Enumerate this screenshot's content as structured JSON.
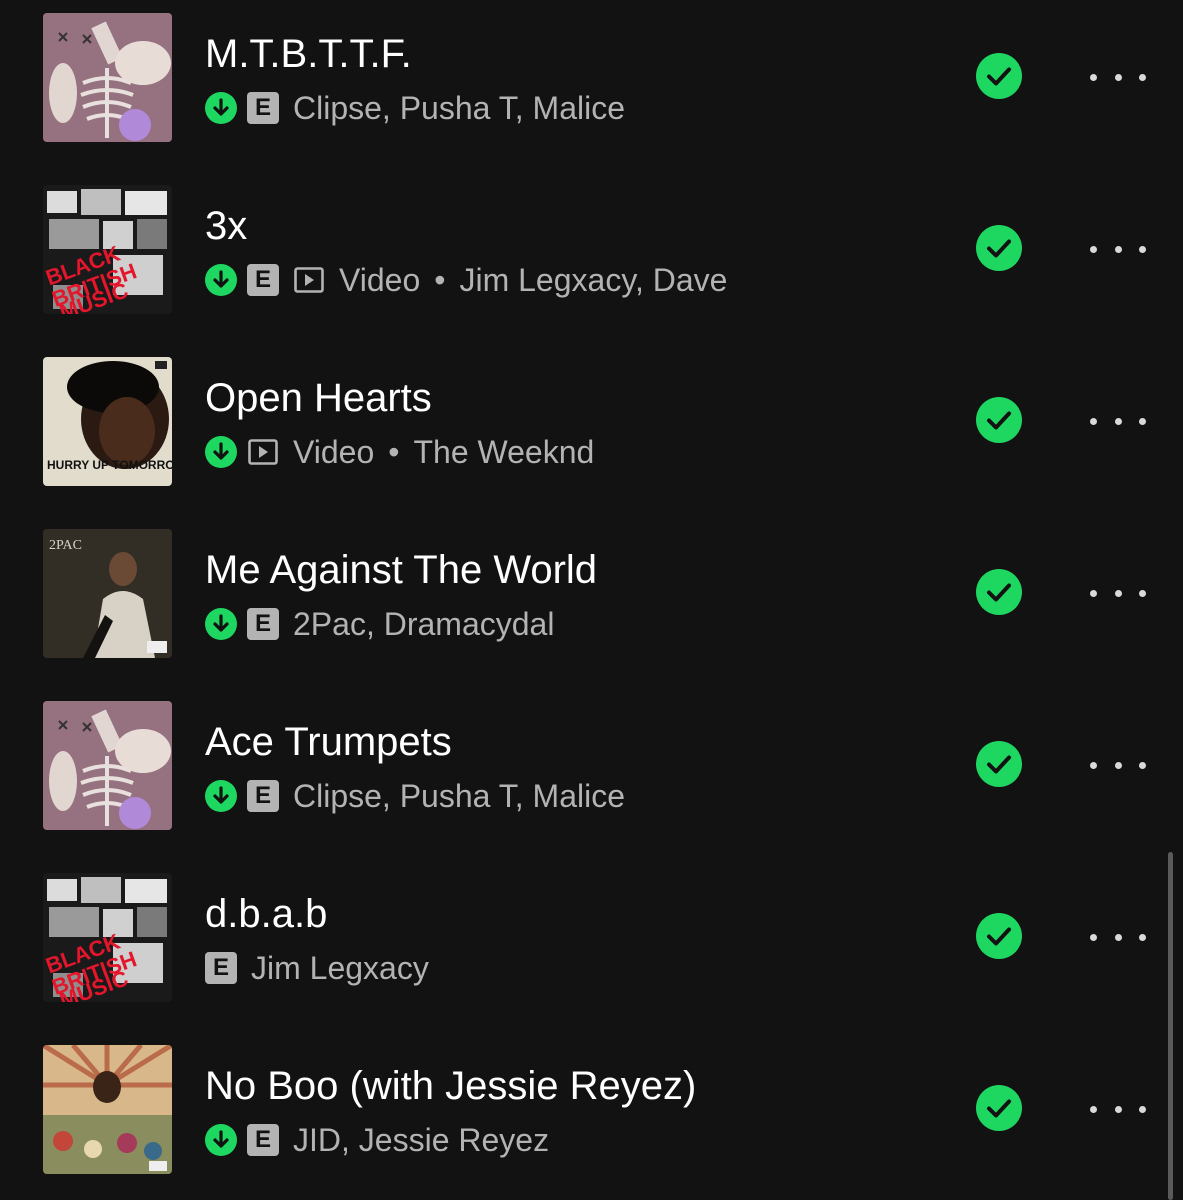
{
  "tracks": [
    {
      "title": "M.T.B.T.T.F.",
      "downloaded": true,
      "explicit_label": "E",
      "artists": "Clipse, Pusha T, Malice",
      "cover_icon": "album-art-clipse",
      "added": true
    },
    {
      "title": "3x",
      "downloaded": true,
      "explicit_label": "E",
      "type_label": "Video",
      "separator": "•",
      "artists": "Jim Legxacy, Dave",
      "cover_icon": "album-art-black-british-music",
      "added": true
    },
    {
      "title": "Open Hearts",
      "downloaded": true,
      "type_label": "Video",
      "separator": "•",
      "artists": "The Weeknd",
      "cover_icon": "album-art-hurry-up-tomorrow",
      "cover_text": "HURRY UP TOMORROW",
      "added": true
    },
    {
      "title": "Me Against The World",
      "downloaded": true,
      "explicit_label": "E",
      "artists": "2Pac, Dramacydal",
      "cover_icon": "album-art-me-against-the-world",
      "cover_text": "2PAC",
      "added": true
    },
    {
      "title": "Ace Trumpets",
      "downloaded": true,
      "explicit_label": "E",
      "artists": "Clipse, Pusha T, Malice",
      "cover_icon": "album-art-clipse",
      "added": true
    },
    {
      "title": "d.b.a.b",
      "downloaded": false,
      "explicit_label": "E",
      "artists": "Jim Legxacy",
      "cover_icon": "album-art-black-british-music",
      "added": true
    },
    {
      "title": "No Boo (with Jessie Reyez)",
      "downloaded": true,
      "explicit_label": "E",
      "artists": "JID, Jessie Reyez",
      "cover_icon": "album-art-jid",
      "added": true
    }
  ],
  "colors": {
    "background": "#121212",
    "accent_green": "#1ed760",
    "secondary_text": "#b3b3b3",
    "primary_text": "#ffffff"
  },
  "icons": {
    "download": "download-arrow-icon",
    "explicit": "explicit-badge",
    "video": "video-play-icon",
    "added": "checkmark-icon",
    "more": "more-options-icon"
  }
}
